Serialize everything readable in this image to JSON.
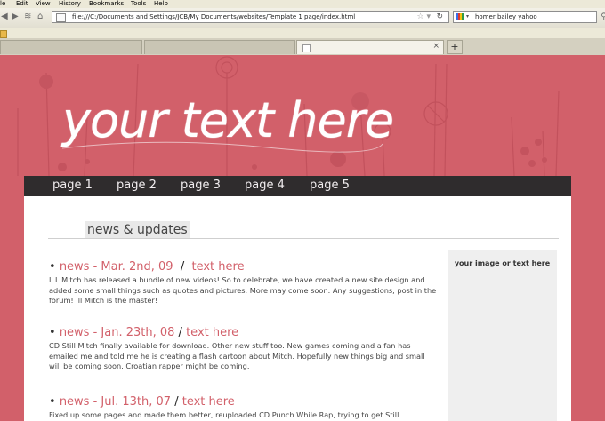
{
  "browser": {
    "menu": [
      "le",
      "Edit",
      "View",
      "History",
      "Bookmarks",
      "Tools",
      "Help"
    ],
    "url": "file:///C:/Documents and Settings/JCB/My Documents/websites/Template 1 page/index.html",
    "search_value": "homer bailey yahoo",
    "new_tab_label": "+",
    "tab_close": "×"
  },
  "site": {
    "title": "your text here",
    "nav": [
      "page 1",
      "page 2",
      "page 3",
      "page 4",
      "page 5"
    ],
    "section_title": "news & updates",
    "sidebar_text": "your image or text here",
    "news": [
      {
        "date": "news - Mar. 2nd, 09",
        "sep": "/",
        "link": "text here",
        "body": "ILL Mitch has released a bundle of new videos! So to celebrate, we have created a new site design and added some small things such as quotes and pictures. More may come soon. Any suggestions, post in the forum! Ill Mitch is the master!"
      },
      {
        "date": "news - Jan. 23th, 08",
        "sep": "/",
        "link": "text here",
        "body": "CD Still Mitch finally available for download. Other new stuff too. New games coming and a fan has emailed me and told me he is creating a flash cartoon about Mitch. Hopefully new things big and small will be coming soon. Croatian rapper might be coming."
      },
      {
        "date": "news - Jul. 13th, 07",
        "sep": "/",
        "link": "text here",
        "body": "Fixed up some pages and made them better, reuploaded CD Punch While Rap, trying to get Still"
      }
    ]
  },
  "colors": {
    "accent": "#d2606a",
    "nav_bg": "#2f2c2d",
    "content_bg": "#ffffff",
    "sidebar_bg": "#efefef"
  }
}
